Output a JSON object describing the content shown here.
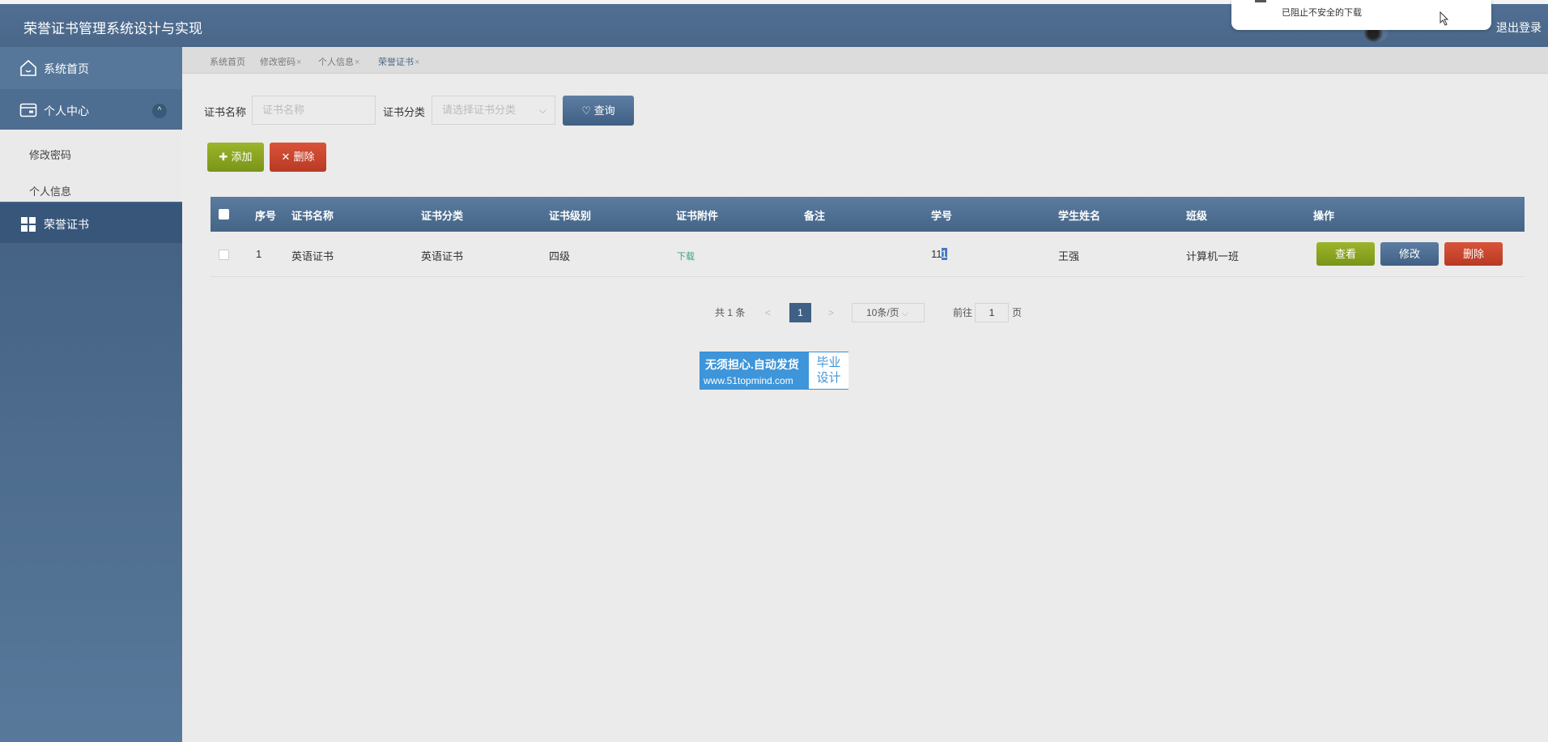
{
  "header": {
    "title": "荣誉证书管理系统设计与实现",
    "logout_label": "退出登录"
  },
  "popup": {
    "message": "已阻止不安全的下载"
  },
  "sidebar": {
    "items": [
      {
        "label": "系统首页",
        "icon": "home-icon"
      },
      {
        "label": "个人中心",
        "icon": "wallet-icon"
      },
      {
        "label": "荣誉证书",
        "icon": "grid-icon"
      }
    ],
    "submenu": [
      {
        "label": "修改密码"
      },
      {
        "label": "个人信息"
      }
    ],
    "collapse_glyph": "^"
  },
  "tabs": [
    {
      "label": "系统首页",
      "close": ""
    },
    {
      "label": "修改密码",
      "close": "×"
    },
    {
      "label": "个人信息",
      "close": "×"
    },
    {
      "label": "荣誉证书",
      "close": "×"
    }
  ],
  "search": {
    "name_label": "证书名称",
    "name_placeholder": "证书名称",
    "category_label": "证书分类",
    "category_placeholder": "请选择证书分类",
    "query_label": "查询",
    "query_icon": "♡"
  },
  "actions": {
    "add_label": "添加",
    "add_icon": "✚",
    "delete_label": "删除",
    "delete_icon": "✕"
  },
  "table": {
    "columns": [
      "序号",
      "证书名称",
      "证书分类",
      "证书级别",
      "证书附件",
      "备注",
      "学号",
      "学生姓名",
      "班级",
      "操作"
    ],
    "rows": [
      {
        "index": "1",
        "name": "英语证书",
        "category": "英语证书",
        "level": "四级",
        "attachment": "下载",
        "remark": "",
        "student_id_a": "11",
        "student_id_b": "1",
        "student_name": "王强",
        "class": "计算机一班",
        "view_label": "查看",
        "edit_label": "修改",
        "delete_label": "删除"
      }
    ]
  },
  "pagination": {
    "total": "共 1 条",
    "prev": "<",
    "current": "1",
    "next": ">",
    "page_size": "10条/页",
    "page_size_arrow": "⌵",
    "goto_label": "前往",
    "goto_value": "1",
    "page_unit": "页"
  },
  "banner": {
    "line1": "无须担心.自动发货",
    "line2": "www.51topmind.com",
    "right_1": "毕业",
    "right_2": "设计"
  },
  "colors": {
    "header": "#4a6789",
    "accent_green": "#8aa521",
    "accent_red": "#c9452d",
    "sidebar": "#3e5a7c"
  }
}
